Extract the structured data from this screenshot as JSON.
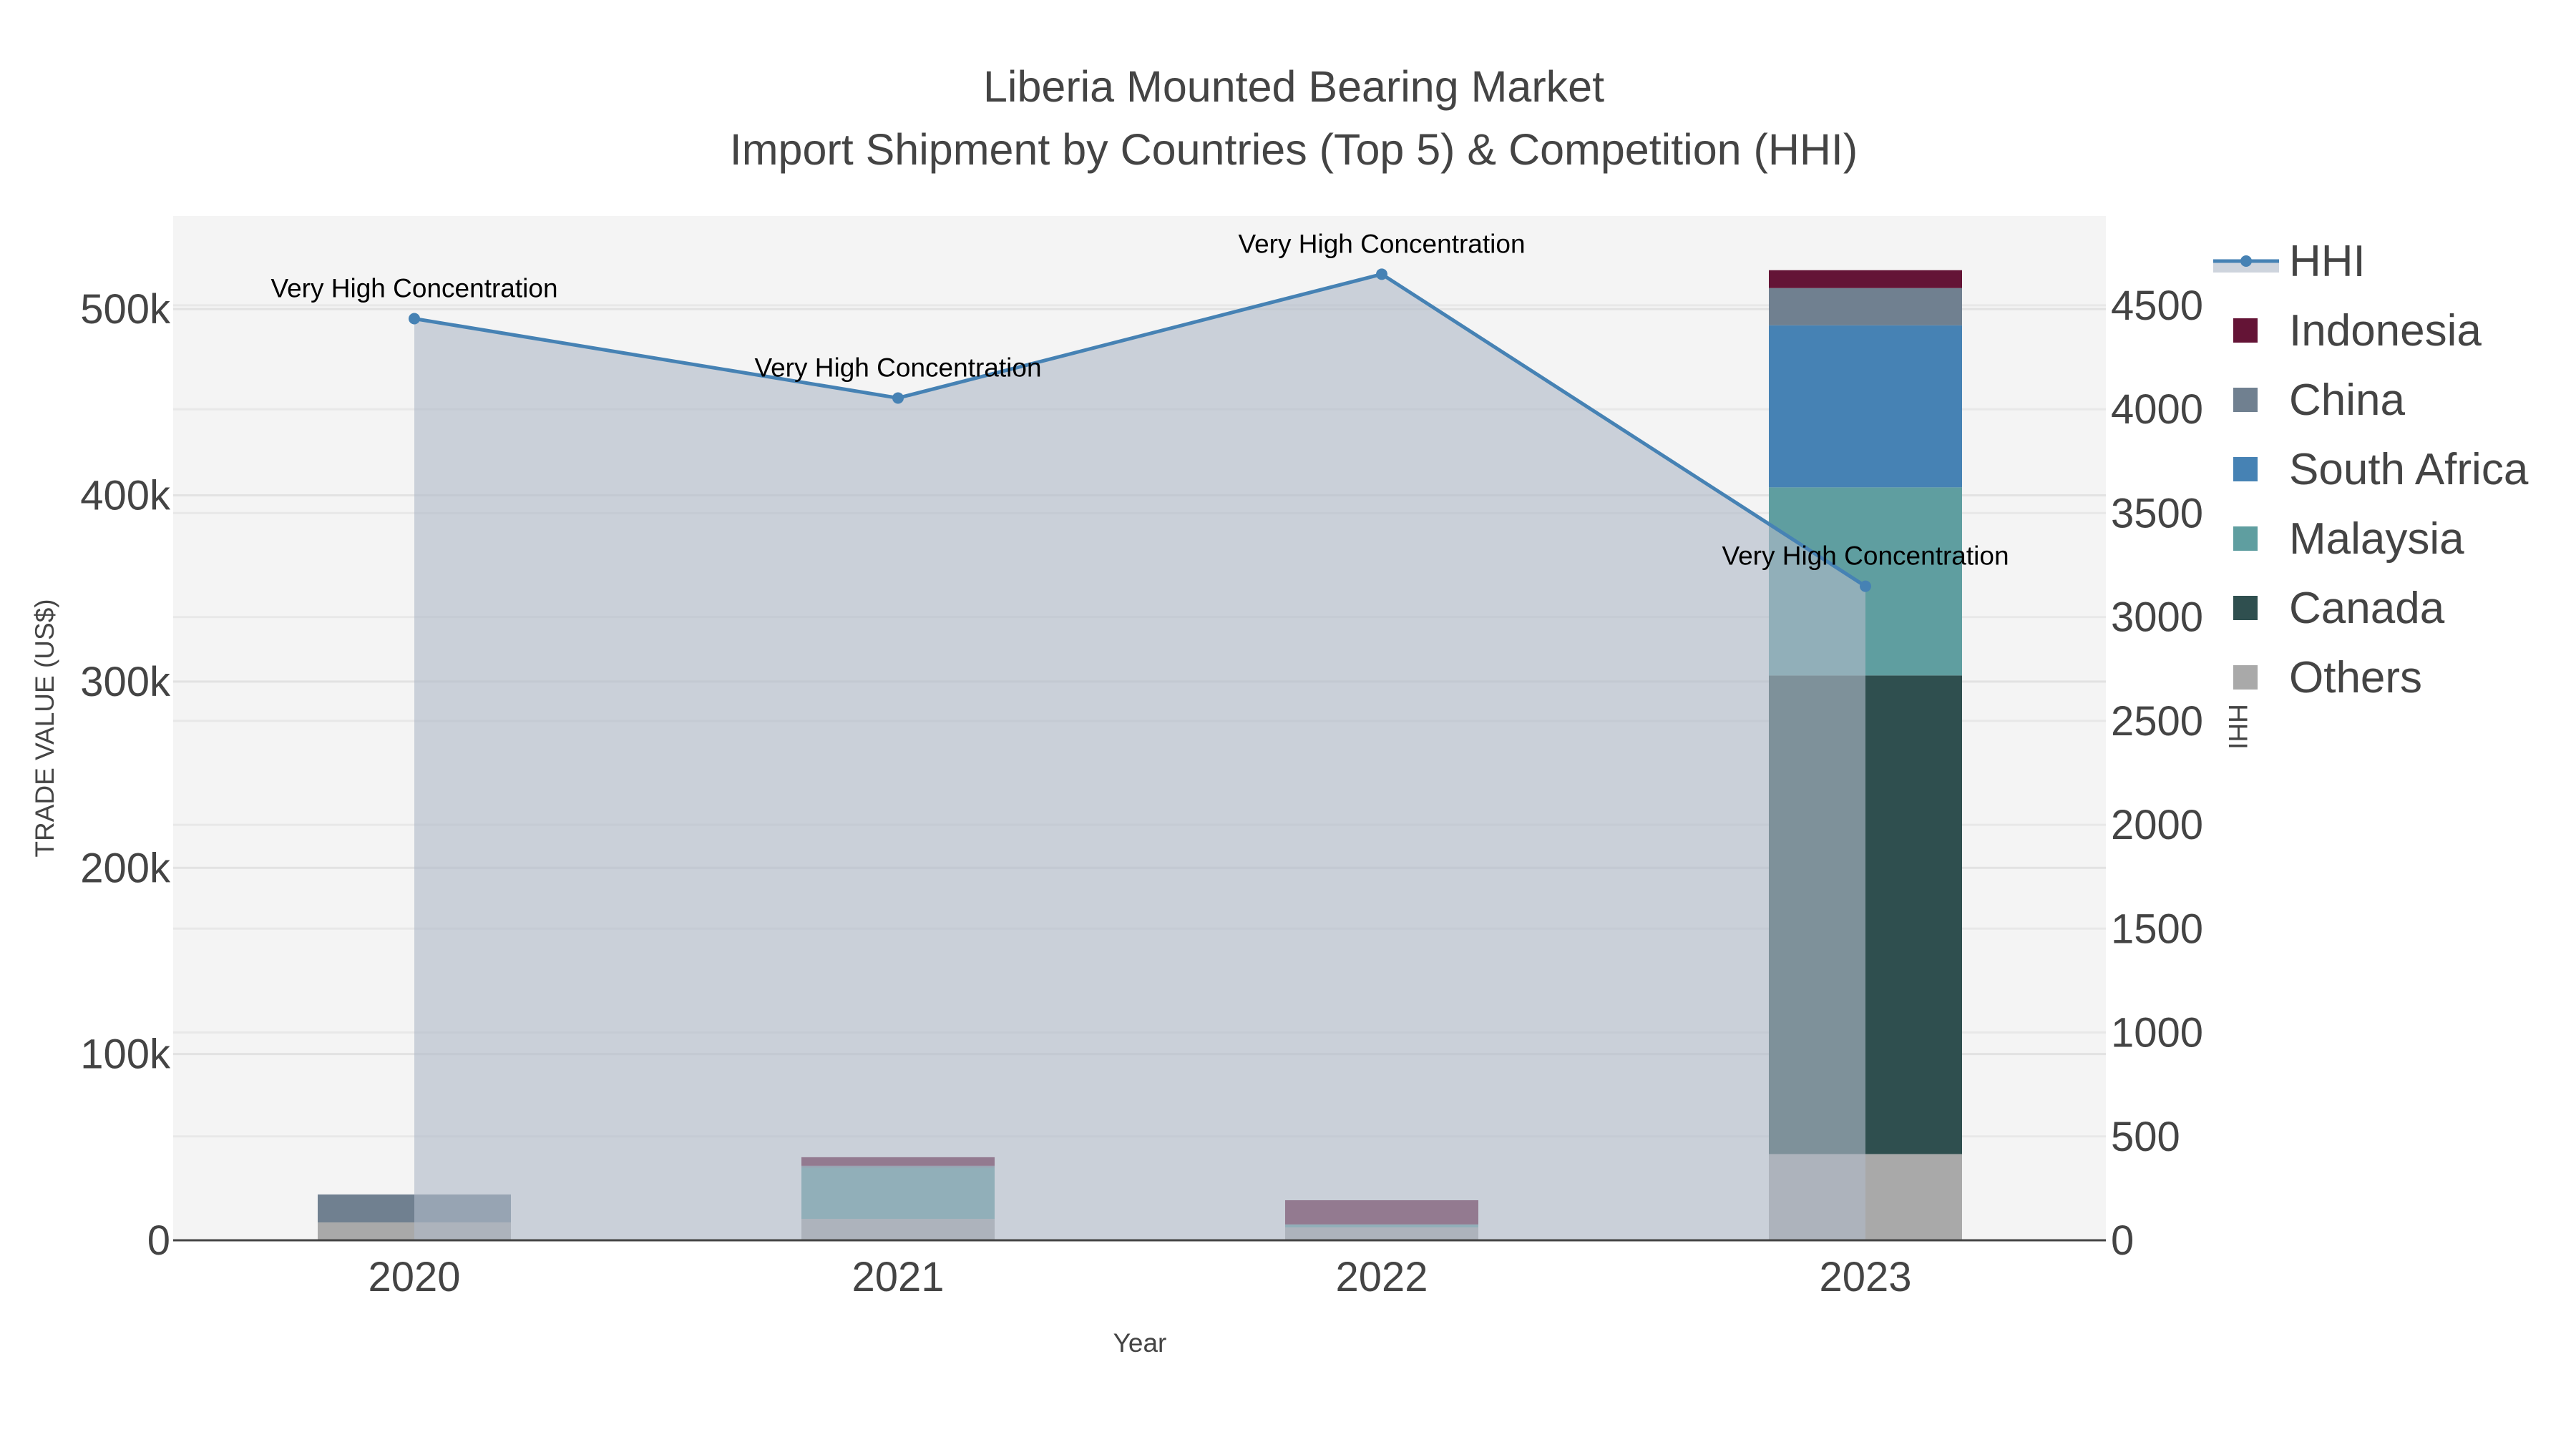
{
  "chart_data": {
    "type": "bar",
    "stacked": true,
    "title": "Liberia Mounted Bearing Market",
    "subtitle": "Import Shipment by Countries (Top 5) & Competition (HHI)",
    "xlabel": "Year",
    "ylabel": "TRADE VALUE (US$)",
    "y2label": "HHI",
    "categories": [
      "2020",
      "2021",
      "2022",
      "2023"
    ],
    "ylim": [
      0,
      550000
    ],
    "y2lim": [
      0,
      4930
    ],
    "yticks": [
      0,
      100000,
      200000,
      300000,
      400000,
      500000
    ],
    "ytick_labels": [
      "0",
      "100k",
      "200k",
      "300k",
      "400k",
      "500k"
    ],
    "y2ticks": [
      0,
      500,
      1000,
      1500,
      2000,
      2500,
      3000,
      3500,
      4000,
      4500
    ],
    "y2tick_labels": [
      "0",
      "500",
      "1000",
      "1500",
      "2000",
      "2500",
      "3000",
      "3500",
      "4000",
      "4500"
    ],
    "grid": true,
    "legend_position": "right",
    "series": [
      {
        "name": "Others",
        "color": "#a9a9a9",
        "values": [
          9600,
          11500,
          6900,
          46300
        ]
      },
      {
        "name": "Canada",
        "color": "#2f4f4f",
        "values": [
          0,
          0,
          0,
          257000
        ]
      },
      {
        "name": "Malaysia",
        "color": "#5f9ea0",
        "values": [
          0,
          27500,
          1600,
          101000
        ]
      },
      {
        "name": "South Africa",
        "color": "#4682b4",
        "values": [
          0,
          0,
          0,
          87000
        ]
      },
      {
        "name": "China",
        "color": "#708090",
        "values": [
          15000,
          1000,
          0,
          20000
        ]
      },
      {
        "name": "Indonesia",
        "color": "#641436",
        "values": [
          0,
          4600,
          13000,
          9600
        ]
      }
    ],
    "hhi": {
      "name": "HHI",
      "color": "#4682b4",
      "fill": "rgba(176,186,200,0.62)",
      "values": [
        4436,
        4054,
        4650,
        3148
      ],
      "annotations": [
        "Very High Concentration",
        "Very High Concentration",
        "Very High Concentration",
        "Very High Concentration"
      ]
    },
    "legend": [
      "HHI",
      "Indonesia",
      "China",
      "South Africa",
      "Malaysia",
      "Canada",
      "Others"
    ]
  }
}
